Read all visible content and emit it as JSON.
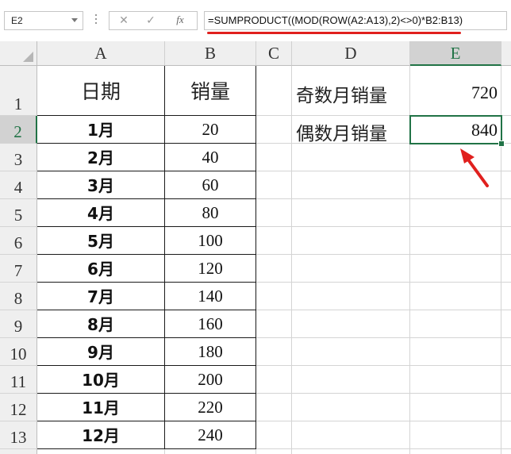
{
  "name_box": {
    "value": "E2"
  },
  "formula_bar": {
    "cancel_icon": "✕",
    "enter_icon": "✓",
    "function_icon": "fx",
    "formula": "=SUMPRODUCT((MOD(ROW(A2:A13),2)<>0)*B2:B13)"
  },
  "columns": [
    "A",
    "B",
    "C",
    "D",
    "E"
  ],
  "selected_column": "E",
  "rows": [
    "1",
    "2",
    "3",
    "4",
    "5",
    "6",
    "7",
    "8",
    "9",
    "10",
    "11",
    "12",
    "13"
  ],
  "selected_row": "2",
  "table": {
    "headers": {
      "date": "日期",
      "sales": "销量"
    },
    "data": [
      {
        "month": "1月",
        "sales": "20"
      },
      {
        "month": "2月",
        "sales": "40"
      },
      {
        "month": "3月",
        "sales": "60"
      },
      {
        "month": "4月",
        "sales": "80"
      },
      {
        "month": "5月",
        "sales": "100"
      },
      {
        "month": "6月",
        "sales": "120"
      },
      {
        "month": "7月",
        "sales": "140"
      },
      {
        "month": "8月",
        "sales": "160"
      },
      {
        "month": "9月",
        "sales": "180"
      },
      {
        "month": "10月",
        "sales": "200"
      },
      {
        "month": "11月",
        "sales": "220"
      },
      {
        "month": "12月",
        "sales": "240"
      }
    ]
  },
  "summary": {
    "odd_label": "奇数月销量",
    "odd_value": "720",
    "even_label": "偶数月销量",
    "even_value": "840"
  },
  "colors": {
    "selection": "#217346",
    "annotation": "#e0201e"
  }
}
